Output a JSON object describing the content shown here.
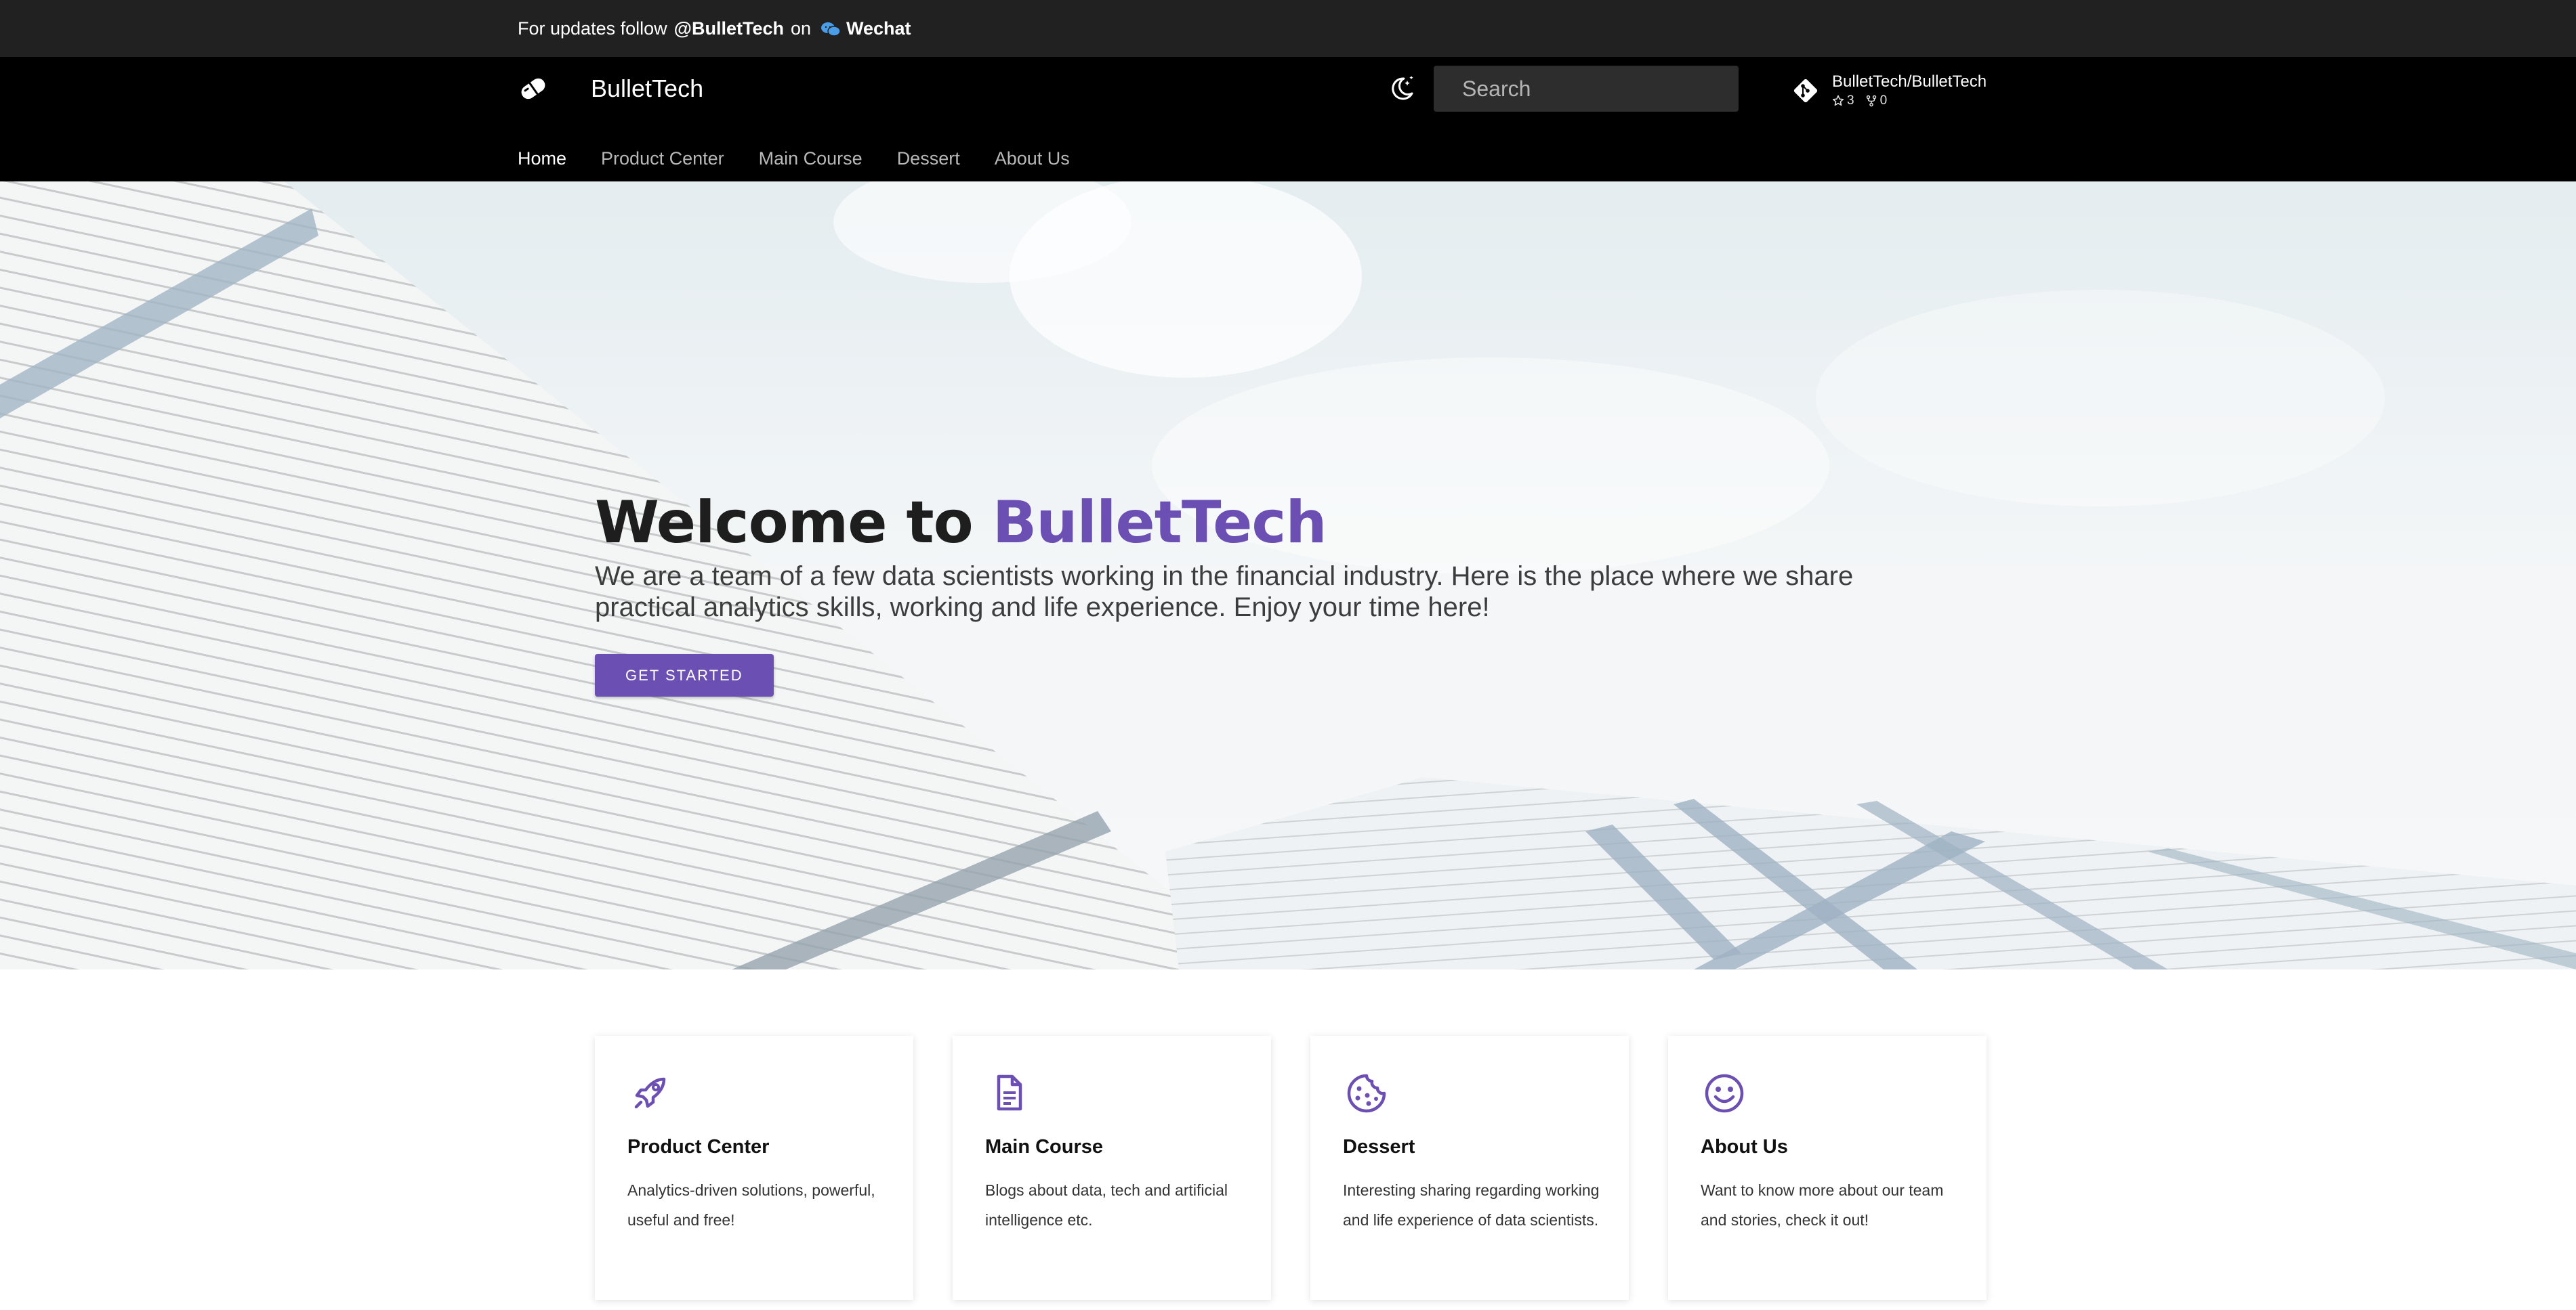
{
  "announcement": {
    "prefix": "For updates follow",
    "handle": "@BulletTech",
    "on": "on",
    "platform": "Wechat"
  },
  "header": {
    "site_title": "BulletTech",
    "search": {
      "placeholder": "Search",
      "value": ""
    },
    "repo": {
      "name": "BulletTech/BulletTech",
      "stars": "3",
      "forks": "0"
    },
    "tabs": [
      {
        "label": "Home",
        "active": true
      },
      {
        "label": "Product Center",
        "active": false
      },
      {
        "label": "Main Course",
        "active": false
      },
      {
        "label": "Dessert",
        "active": false
      },
      {
        "label": "About Us",
        "active": false
      }
    ],
    "icons": {
      "logo": "pill-logo-icon",
      "theme": "moon-stars-icon",
      "search": "search-icon",
      "repo": "git-icon",
      "stars": "star-icon",
      "forks": "fork-icon"
    }
  },
  "hero": {
    "title_prefix": "Welcome to",
    "title_accent": "BulletTech",
    "subtitle": "We are a team of a few data scientists working in the financial industry. Here is the place where we share practical analytics skills, working and life experience. Enjoy your time here!",
    "cta_label": "GET STARTED"
  },
  "cards": [
    {
      "icon": "rocket-icon",
      "title": "Product Center",
      "desc": "Analytics-driven solutions, powerful, useful and free!"
    },
    {
      "icon": "document-icon",
      "title": "Main Course",
      "desc": "Blogs about data, tech and artificial intelligence etc."
    },
    {
      "icon": "cookie-icon",
      "title": "Dessert",
      "desc": "Interesting sharing regarding working and life experience of data scientists."
    },
    {
      "icon": "smile-icon",
      "title": "About Us",
      "desc": "Want to know more about our team and stories, check it out!"
    }
  ],
  "colors": {
    "accent": "#6b4fb2",
    "announce_bg": "#212121",
    "header_bg": "#000000",
    "wechat": "#4a9ee8"
  }
}
